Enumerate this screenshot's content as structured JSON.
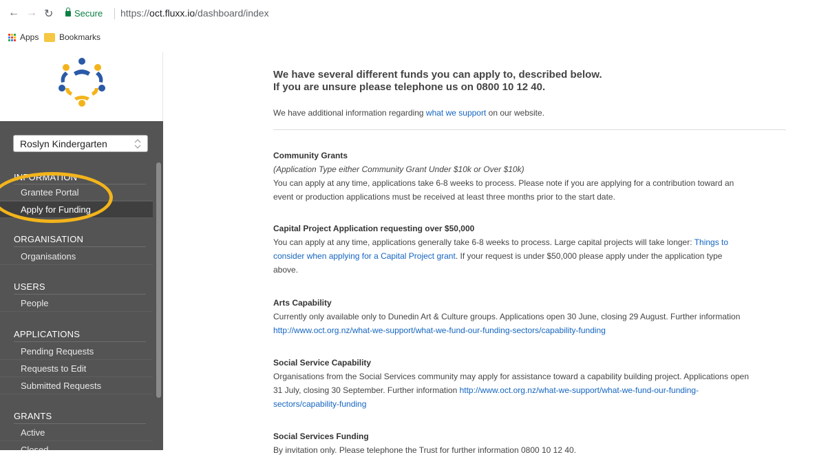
{
  "browser": {
    "secure_label": "Secure",
    "url_scheme": "https://",
    "url_host": "oct.fluxx.io",
    "url_path": "/dashboard/index",
    "bookmarks": [
      "Apps",
      "Bookmarks"
    ]
  },
  "sidebar": {
    "org_select": "Roslyn Kindergarten",
    "sections": [
      {
        "title": "INFORMATION",
        "items": [
          "Grantee Portal",
          "Apply for Funding"
        ]
      },
      {
        "title": "ORGANISATION",
        "items": [
          "Organisations"
        ]
      },
      {
        "title": "USERS",
        "items": [
          "People"
        ]
      },
      {
        "title": "APPLICATIONS",
        "items": [
          "Pending Requests",
          "Requests to Edit",
          "Submitted Requests"
        ]
      },
      {
        "title": "GRANTS",
        "items": [
          "Active",
          "Closed"
        ]
      }
    ],
    "active_item": "Apply for Funding",
    "highlight_color": "#f3b41b"
  },
  "main": {
    "headline_line1": "We have several different funds you can apply to, described below.",
    "headline_line2": "If you are unsure please telephone us on 0800 10 12 40.",
    "intro_before": "We have additional information regarding ",
    "intro_link": "what we support",
    "intro_after": " on our website.",
    "funds": [
      {
        "title": "Community Grants",
        "note": "(Application Type either Community Grant Under $10k or Over $10k)",
        "line1": "You can apply at any time, applications take 6-8 weeks to process.  Please note if you are applying for a contribution toward an",
        "line2": "event or production applications must be received at least three months prior to the start date."
      },
      {
        "title": "Capital Project Application requesting over $50,000",
        "line1_text": "You can apply at any time, applications generally take 6-8 weeks to process.  Large capital projects will take longer: ",
        "line1_link": "Things to",
        "line2_link": "consider when applying for a Capital Project grant",
        "line2_text": ". If your request is under $50,000 please apply under the application type",
        "line3": "above."
      },
      {
        "title": "Arts Capability",
        "line1": "Currently only available only to Dunedin Art & Culture groups.  Applications open 30 June, closing 29 August.  Further information",
        "link": "http://www.oct.org.nz/what-we-support/what-we-fund-our-funding-sectors/capability-funding"
      },
      {
        "title": "Social Service Capability",
        "line1": "Organisations from the Social Services community may apply for assistance toward a capability building project.  Applications open",
        "line2_text": "31 July, closing 30 September.  Further information ",
        "line2_link": "http://www.oct.org.nz/what-we-support/what-we-fund-our-funding-",
        "line3_link": "sectors/capability-funding"
      },
      {
        "title": "Social Services Funding",
        "line1": "By invitation only.  Please telephone the Trust for further information 0800 10 12 40."
      }
    ]
  }
}
